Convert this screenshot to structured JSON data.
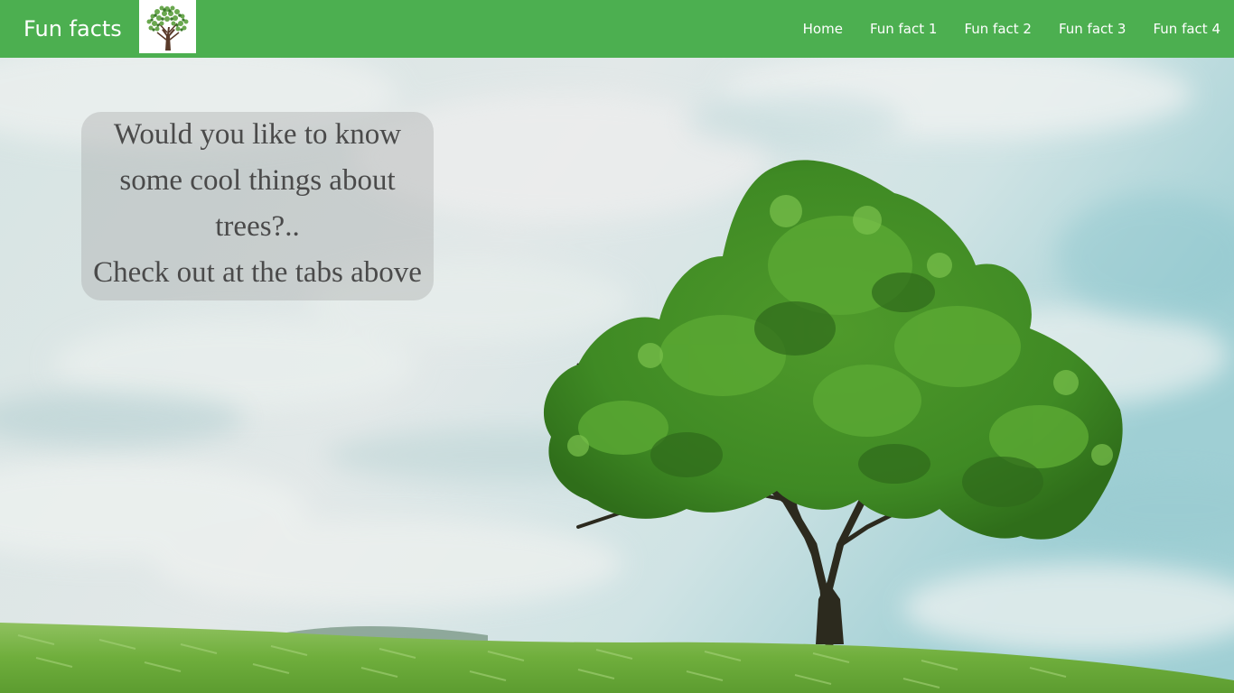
{
  "navbar": {
    "brand": "Fun facts",
    "logo_icon": "tree-logo-icon",
    "links": [
      {
        "label": "Home"
      },
      {
        "label": "Fun fact 1"
      },
      {
        "label": "Fun fact 2"
      },
      {
        "label": "Fun fact 3"
      },
      {
        "label": "Fun fact 4"
      }
    ],
    "color": "#4caf50"
  },
  "hero": {
    "background_image": "tree-in-field-photo",
    "message_lines": [
      "Would you like to know",
      "some cool things about",
      "trees?..",
      "Check out at the tabs above"
    ]
  }
}
